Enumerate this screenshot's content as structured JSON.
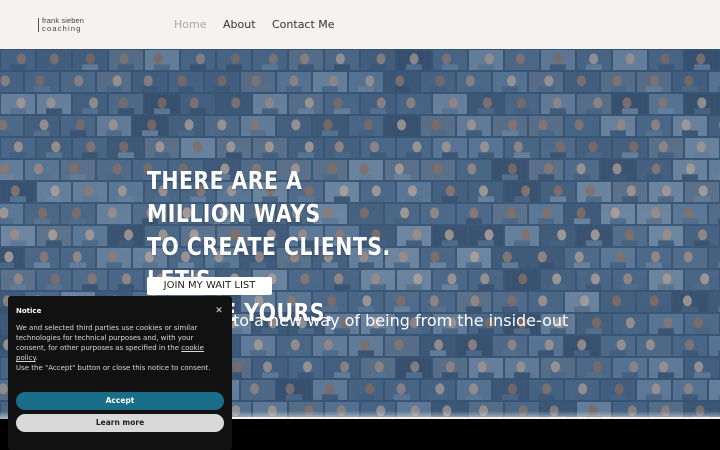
{
  "header": {
    "logo": {
      "line1": "frank sieben",
      "line2": "coaching"
    },
    "nav": [
      {
        "label": "Home",
        "active": true
      },
      {
        "label": "About",
        "active": false
      },
      {
        "label": "Contact Me",
        "active": false
      }
    ]
  },
  "hero": {
    "headline": [
      "THERE ARE A MILLION WAYS",
      "TO CREATE CLIENTS. LET'S",
      "CREATE YOURS."
    ],
    "cta_label": "JOIN MY WAIT LIST",
    "tagline": "to a new way of being from the inside-out"
  },
  "cookie_notice": {
    "title": "Notice",
    "close_icon": "close-icon",
    "body_before_link": "We and selected third parties use cookies or similar technologies for technical purposes and, with your consent, for other purposes as specified in the ",
    "link_text": "cookie policy",
    "body_after_link": ".",
    "body_line2": "Use the \"Accept\" button or close this notice to consent.",
    "accept_label": "Accept",
    "learn_more_label": "Learn more"
  },
  "colors": {
    "header_bg": "#f4f3f0",
    "nav_active": "#a9a9a9",
    "accept_button": "#1b6e8a",
    "notice_bg": "#111111"
  }
}
